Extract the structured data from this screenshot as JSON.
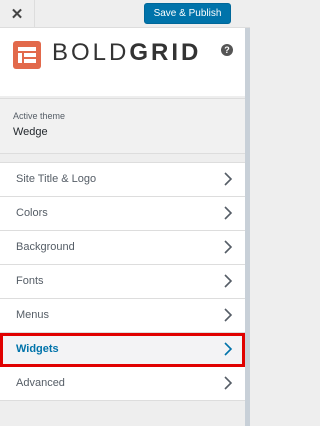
{
  "header": {
    "close_icon": "close-icon",
    "save_label": "Save & Publish"
  },
  "brand": {
    "logo_light": "BOLD",
    "logo_bold": "GRID",
    "help_glyph": "?",
    "accent": "#e2694b"
  },
  "theme": {
    "label": "Active theme",
    "name": "Wedge"
  },
  "menu": {
    "items": [
      {
        "label": "Site Title & Logo"
      },
      {
        "label": "Colors"
      },
      {
        "label": "Background"
      },
      {
        "label": "Fonts"
      },
      {
        "label": "Menus"
      },
      {
        "label": "Widgets",
        "highlighted": true
      },
      {
        "label": "Advanced"
      }
    ]
  }
}
